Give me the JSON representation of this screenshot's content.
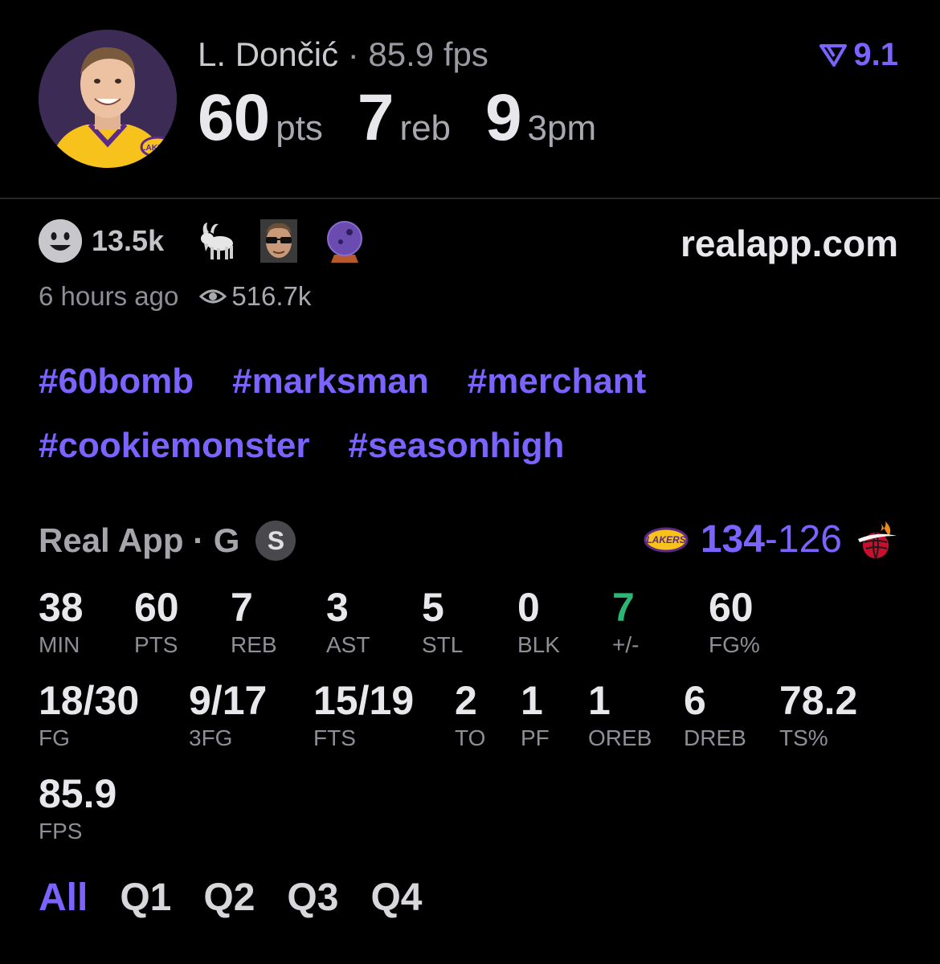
{
  "header": {
    "player_name": "L. Dončić",
    "separator": "·",
    "fps_text": "85.9 fps",
    "rating": "9.1",
    "headline": [
      {
        "value": "60",
        "unit": "pts"
      },
      {
        "value": "7",
        "unit": "reb"
      },
      {
        "value": "9",
        "unit": "3pm"
      }
    ]
  },
  "reactions": {
    "count": "13.5k",
    "emojis": [
      "smiley-icon",
      "goat-icon",
      "sunglasses-player-icon",
      "crystal-ball-icon"
    ]
  },
  "site": "realapp.com",
  "meta": {
    "time_ago": "6 hours ago",
    "views": "516.7k"
  },
  "hashtags": [
    "#60bomb",
    "#marksman",
    "#merchant",
    "#cookiemonster",
    "#seasonhigh"
  ],
  "game": {
    "source": "Real App · G",
    "badge": "S",
    "score_home": "134",
    "score_dash": "-",
    "score_away": "126"
  },
  "stats": [
    {
      "value": "38",
      "label": "MIN"
    },
    {
      "value": "60",
      "label": "PTS"
    },
    {
      "value": "7",
      "label": "REB"
    },
    {
      "value": "3",
      "label": "AST"
    },
    {
      "value": "5",
      "label": "STL"
    },
    {
      "value": "0",
      "label": "BLK"
    },
    {
      "value": "7",
      "label": "+/-"
    },
    {
      "value": "60",
      "label": "FG%"
    },
    {
      "value": "18/30",
      "label": "FG"
    },
    {
      "value": "9/17",
      "label": "3FG"
    },
    {
      "value": "15/19",
      "label": "FTS"
    },
    {
      "value": "2",
      "label": "TO"
    },
    {
      "value": "1",
      "label": "PF"
    },
    {
      "value": "1",
      "label": "OREB"
    },
    {
      "value": "6",
      "label": "DREB"
    },
    {
      "value": "78.2",
      "label": "TS%"
    },
    {
      "value": "85.9",
      "label": "FPS"
    }
  ],
  "quarters": [
    "All",
    "Q1",
    "Q2",
    "Q3",
    "Q4"
  ],
  "colors": {
    "accent": "#7a63ff",
    "positive": "#2bb673",
    "background": "#000000"
  }
}
